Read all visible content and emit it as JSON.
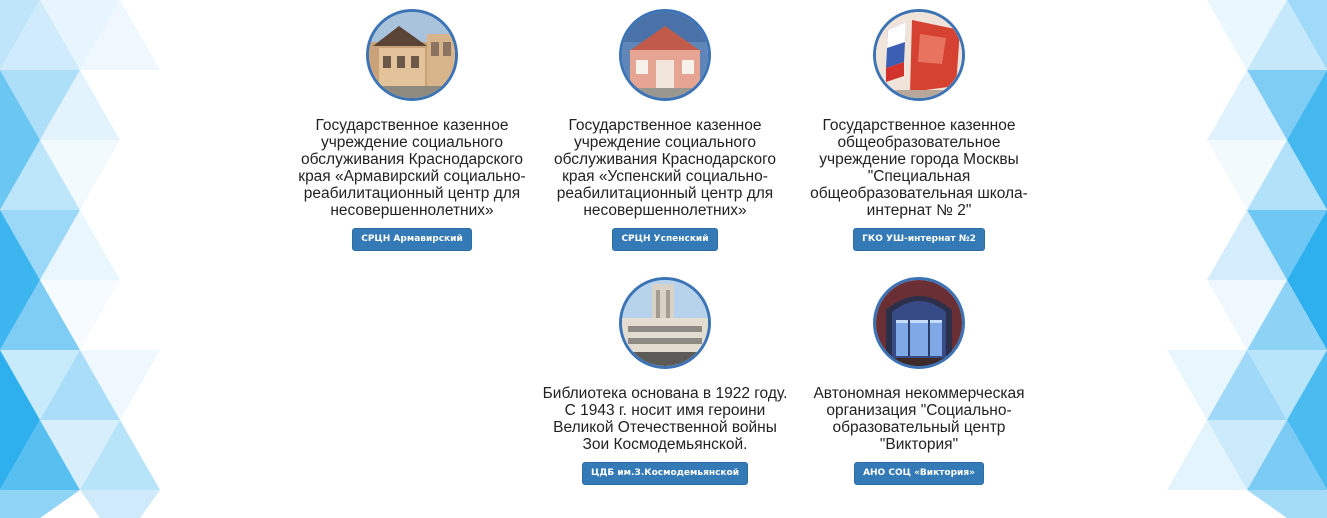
{
  "cards": [
    {
      "description": "Государственное казенное учреждение социального обслуживания Краснодарского края «Армавирский социально-реабилитационный центр для несовершеннолетних»",
      "button_label": "СРЦН Армавирский"
    },
    {
      "description": "Государственное казенное учреждение социального обслуживания Краснодарского края «Успенский социально-реабилитационный центр для несовершеннолетних»",
      "button_label": "СРЦН Успенский"
    },
    {
      "description": "Государственное казенное общеобразовательное учреждение города Москвы \"Специальная общеобразовательная школа-интернат № 2\"",
      "button_label": "ГКО УШ-интернат №2"
    },
    {
      "description": "Библиотека основана в 1922 году. С 1943 г. носит имя героини Великой Отечественной войны Зои Космодемьянской.",
      "button_label": "ЦДБ им.З.Космодемьянской"
    },
    {
      "description": "Автономная некоммерческая организация \"Социально-образовательный центр \"Виктория\"",
      "button_label": "АНО СОЦ «Виктория»"
    }
  ],
  "colors": {
    "button_bg": "#337ab7",
    "photo_border": "#3b73b5",
    "triangle_light": "#d9eefc",
    "triangle_mid": "#8fd0f5",
    "triangle_dark": "#2fb0ee"
  }
}
